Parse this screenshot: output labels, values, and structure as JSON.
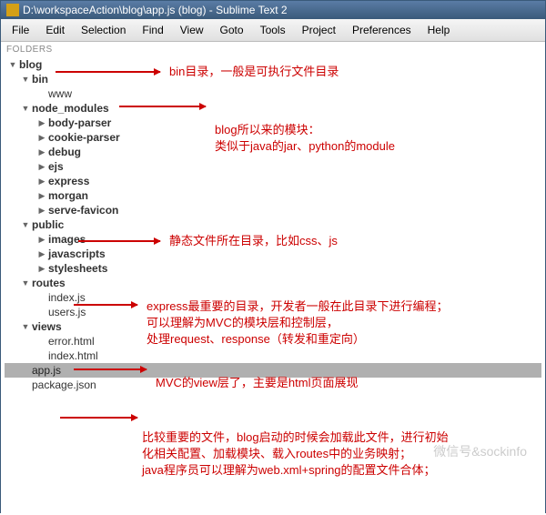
{
  "title": "D:\\workspaceAction\\blog\\app.js (blog) - Sublime Text 2",
  "menu": [
    "File",
    "Edit",
    "Selection",
    "Find",
    "View",
    "Goto",
    "Tools",
    "Project",
    "Preferences",
    "Help"
  ],
  "folders_label": "FOLDERS",
  "tree": {
    "root": "blog",
    "bin": "bin",
    "www": "www",
    "node_modules": "node_modules",
    "nm_items": [
      "body-parser",
      "cookie-parser",
      "debug",
      "ejs",
      "express",
      "morgan",
      "serve-favicon"
    ],
    "public": "public",
    "public_items": [
      "images",
      "javascripts",
      "stylesheets"
    ],
    "routes": "routes",
    "routes_items": [
      "index.js",
      "users.js"
    ],
    "views": "views",
    "views_items": [
      "error.html",
      "index.html"
    ],
    "app_js": "app.js",
    "package_json": "package.json"
  },
  "annotations": {
    "bin": "bin目录，一般是可执行文件目录",
    "nm1": "blog所以来的模块：",
    "nm2": "类似于java的jar、python的module",
    "public": "静态文件所在目录，比如css、js",
    "routes1": "express最重要的目录，开发者一般在此目录下进行编程；",
    "routes2": "可以理解为MVC的模块层和控制层，",
    "routes3": "处理request、response（转发和重定向）",
    "views": "MVC的view层了，主要是html页面展现",
    "app1": "比较重要的文件，blog启动的时候会加载此文件，进行初始",
    "app2": "化相关配置、加载模块、载入routes中的业务映射；",
    "app3": "java程序员可以理解为web.xml+spring的配置文件合体；"
  },
  "watermark": "微信号&sockinfo"
}
